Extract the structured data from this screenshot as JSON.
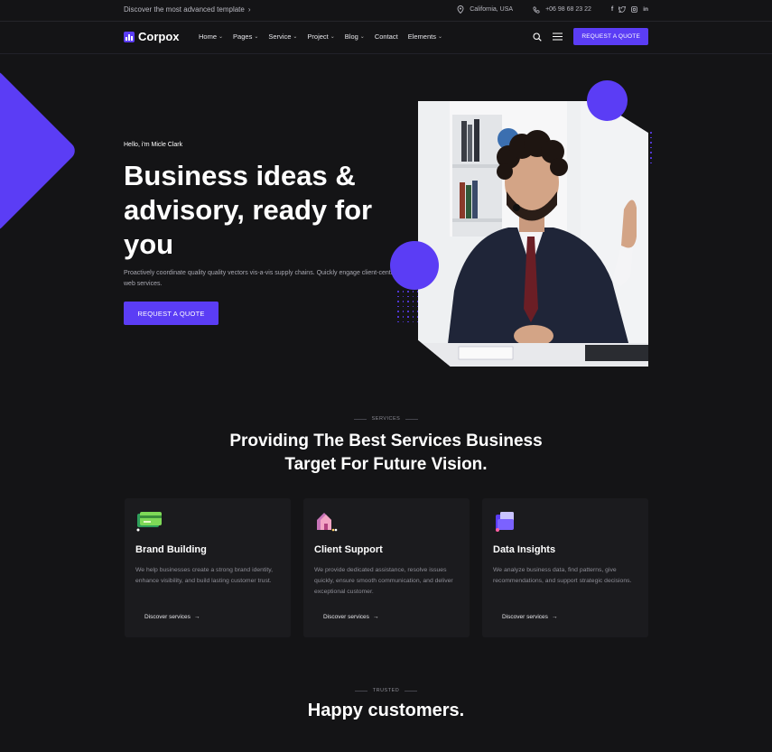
{
  "topbar": {
    "announcement": "Discover the most advanced template",
    "location": "California, USA",
    "phone": "+06 98 68 23 22",
    "social_icons": [
      "facebook-icon",
      "twitter-icon",
      "instagram-icon",
      "linkedin-icon"
    ]
  },
  "header": {
    "logo": "Corpox",
    "nav": [
      {
        "label": "Home",
        "has_dropdown": true
      },
      {
        "label": "Pages",
        "has_dropdown": true
      },
      {
        "label": "Service",
        "has_dropdown": true
      },
      {
        "label": "Project",
        "has_dropdown": true
      },
      {
        "label": "Blog",
        "has_dropdown": true
      },
      {
        "label": "Contact",
        "has_dropdown": false
      },
      {
        "label": "Elements",
        "has_dropdown": true
      }
    ],
    "cta": "REQUEST A QUOTE"
  },
  "hero": {
    "greeting": "Hello, i'm Micle Clark",
    "title": "Business ideas & advisory, ready for you",
    "description": "Proactively coordinate quality quality vectors vis-a-vis supply chains. Quickly engage client-centric web services.",
    "cta": "REQUEST A QUOTE"
  },
  "services": {
    "eyebrow": "SERVICES",
    "title_line1": "Providing The Best Services Business",
    "title_line2": "Target For Future Vision.",
    "cards": [
      {
        "title": "Brand Building",
        "description": "We help businesses create a strong brand identity, enhance visibility, and build lasting customer trust.",
        "link": "Discover services",
        "icon": "credit-card-icon"
      },
      {
        "title": "Client Support",
        "description": "We provide dedicated assistance, resolve issues quickly, ensure smooth communication, and deliver exceptional customer.",
        "link": "Discover services",
        "icon": "home-chat-icon"
      },
      {
        "title": "Data Insights",
        "description": "We analyze business data, find patterns, give recommendations, and support strategic decisions.",
        "link": "Discover services",
        "icon": "folder-icon"
      }
    ]
  },
  "trusted": {
    "eyebrow": "TRUSTED",
    "title": "Happy customers."
  },
  "colors": {
    "accent": "#5b3df5",
    "background": "#141416",
    "card": "#1b1b1e"
  }
}
